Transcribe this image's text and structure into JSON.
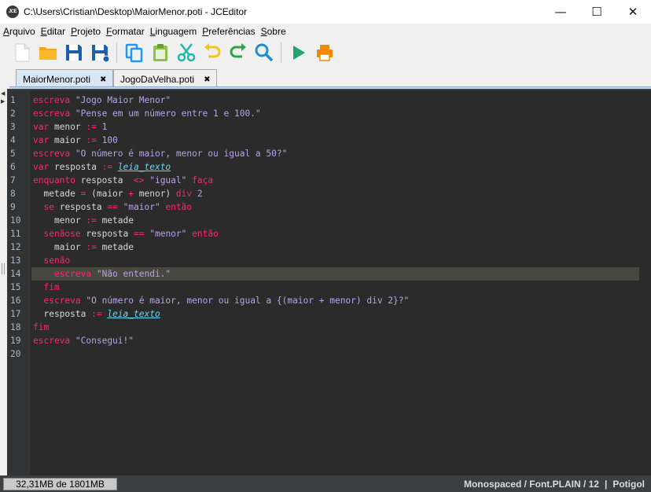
{
  "window": {
    "logo_text": "JCE",
    "title": "C:\\Users\\Cristian\\Desktop\\MaiorMenor.poti - JCEditor",
    "minimize": "—",
    "maximize": "☐",
    "close": "✕"
  },
  "menu": [
    {
      "first": "A",
      "rest": "rquivo"
    },
    {
      "first": "E",
      "rest": "ditar"
    },
    {
      "first": "P",
      "rest": "rojeto"
    },
    {
      "first": "F",
      "rest": "ormatar"
    },
    {
      "first": "L",
      "rest": "inguagem"
    },
    {
      "first": "P",
      "rest": "referências"
    },
    {
      "first": "S",
      "rest": "obre"
    }
  ],
  "toolbar": [
    {
      "name": "new-file-icon",
      "color": "#ffffff"
    },
    {
      "name": "open-folder-icon",
      "color": "#f5a623"
    },
    {
      "name": "save-icon",
      "color": "#1e5fa8"
    },
    {
      "name": "save-as-icon",
      "color": "#1e5fa8"
    },
    {
      "name": "copy-icon",
      "color": "#2196f3"
    },
    {
      "name": "paste-icon",
      "color": "#8bc34a"
    },
    {
      "name": "cut-icon",
      "color": "#1fb8a6"
    },
    {
      "name": "undo-icon",
      "color": "#f5c518"
    },
    {
      "name": "redo-icon",
      "color": "#2aa745"
    },
    {
      "name": "search-icon",
      "color": "#1e90d0"
    },
    {
      "name": "run-icon",
      "color": "#1fa56b"
    },
    {
      "name": "print-icon",
      "color": "#f08a00"
    }
  ],
  "tabs": [
    {
      "label": "MaiorMenor.poti",
      "close": "✖",
      "active": true
    },
    {
      "label": "JogoDaVelha.poti",
      "close": "✖",
      "active": false
    }
  ],
  "editor": {
    "highlighted_line": 14,
    "lines": [
      [
        [
          "kw",
          "escreva"
        ],
        [
          "id",
          " "
        ],
        [
          "str",
          "\"Jogo Maior Menor\""
        ]
      ],
      [
        [
          "kw",
          "escreva"
        ],
        [
          "id",
          " "
        ],
        [
          "str",
          "\"Pense em um número entre 1 e 100.\""
        ]
      ],
      [
        [
          "kw",
          "var"
        ],
        [
          "id",
          " menor "
        ],
        [
          "kw",
          ":="
        ],
        [
          "id",
          " "
        ],
        [
          "str",
          "1"
        ]
      ],
      [
        [
          "kw",
          "var"
        ],
        [
          "id",
          " maior "
        ],
        [
          "kw",
          ":="
        ],
        [
          "id",
          " "
        ],
        [
          "str",
          "100"
        ]
      ],
      [
        [
          "kw",
          "escreva"
        ],
        [
          "id",
          " "
        ],
        [
          "str",
          "\"O número é maior, menor ou igual a 50?\""
        ]
      ],
      [
        [
          "kw",
          "var"
        ],
        [
          "id",
          " resposta "
        ],
        [
          "kw",
          ":="
        ],
        [
          "id",
          " "
        ],
        [
          "fn",
          "leia_texto"
        ]
      ],
      [
        [
          "kw",
          "enquanto"
        ],
        [
          "id",
          " resposta  "
        ],
        [
          "kw",
          "<>"
        ],
        [
          "id",
          " "
        ],
        [
          "str",
          "\"igual\""
        ],
        [
          "id",
          " "
        ],
        [
          "kw",
          "faça"
        ]
      ],
      [
        [
          "id",
          "  metade "
        ],
        [
          "kw",
          "="
        ],
        [
          "id",
          " (maior "
        ],
        [
          "kw",
          "+"
        ],
        [
          "id",
          " menor) "
        ],
        [
          "kw",
          "div"
        ],
        [
          "id",
          " "
        ],
        [
          "str",
          "2"
        ]
      ],
      [
        [
          "id",
          "  "
        ],
        [
          "kw",
          "se"
        ],
        [
          "id",
          " resposta "
        ],
        [
          "kw",
          "=="
        ],
        [
          "id",
          " "
        ],
        [
          "str",
          "\"maior\""
        ],
        [
          "id",
          " "
        ],
        [
          "kw",
          "então"
        ]
      ],
      [
        [
          "id",
          "    menor "
        ],
        [
          "kw",
          ":="
        ],
        [
          "id",
          " metade"
        ]
      ],
      [
        [
          "id",
          "  "
        ],
        [
          "kw",
          "senãose"
        ],
        [
          "id",
          " resposta "
        ],
        [
          "kw",
          "=="
        ],
        [
          "id",
          " "
        ],
        [
          "str",
          "\"menor\""
        ],
        [
          "id",
          " "
        ],
        [
          "kw",
          "então"
        ]
      ],
      [
        [
          "id",
          "    maior "
        ],
        [
          "kw",
          ":="
        ],
        [
          "id",
          " metade"
        ]
      ],
      [
        [
          "id",
          "  "
        ],
        [
          "kw",
          "senão"
        ]
      ],
      [
        [
          "id",
          "    "
        ],
        [
          "kw",
          "escreva"
        ],
        [
          "id",
          " "
        ],
        [
          "str",
          "\"Não entendi.\""
        ]
      ],
      [
        [
          "id",
          "  "
        ],
        [
          "kw",
          "fim"
        ]
      ],
      [
        [
          "id",
          "  "
        ],
        [
          "kw",
          "escreva"
        ],
        [
          "id",
          " "
        ],
        [
          "str",
          "\"O número é maior, menor ou igual a {(maior + menor) div 2}?\""
        ]
      ],
      [
        [
          "id",
          "  resposta "
        ],
        [
          "kw",
          ":="
        ],
        [
          "id",
          " "
        ],
        [
          "fn",
          "leia_texto"
        ]
      ],
      [
        [
          "kw",
          "fim"
        ]
      ],
      [
        [
          "kw",
          "escreva"
        ],
        [
          "id",
          " "
        ],
        [
          "str",
          "\"Consegui!\""
        ]
      ],
      []
    ]
  },
  "status": {
    "memory": "32,31MB de 1801MB",
    "font": "Monospaced / Font.PLAIN / 12",
    "separator": "|",
    "language": "Potigol"
  }
}
